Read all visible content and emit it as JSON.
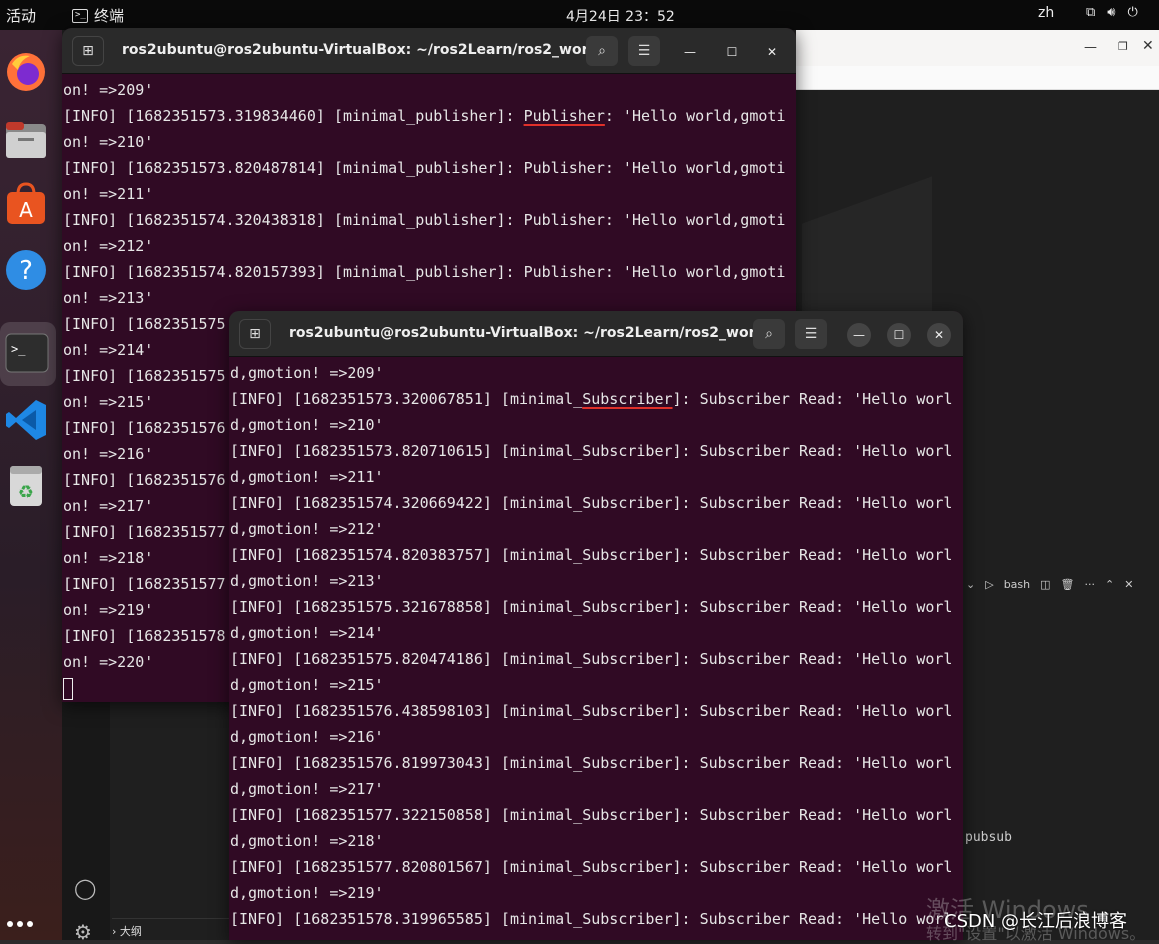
{
  "topbar": {
    "activities": "活动",
    "app": "终端",
    "clock": "4月24日  23：52",
    "lang": "zh"
  },
  "dock": {
    "items": [
      "firefox-icon",
      "files-icon",
      "app-center-icon",
      "help-icon",
      "terminal-icon",
      "vscode-icon",
      "trash-icon",
      "apps-grid-icon"
    ]
  },
  "bg": {
    "panel_label": "bash",
    "pubsub": "pubsub",
    "outline": "大纲"
  },
  "term1": {
    "title": "ros2ubuntu@ros2ubuntu-VirtualBox: ~/ros2Learn/ros2_work...",
    "lines": [
      "on! =>209'",
      "[INFO] [1682351573.319834460] [minimal_publisher]: Publisher: 'Hello world,gmoti",
      "on! =>210'",
      "[INFO] [1682351573.820487814] [minimal_publisher]: Publisher: 'Hello world,gmoti",
      "on! =>211'",
      "[INFO] [1682351574.320438318] [minimal_publisher]: Publisher: 'Hello world,gmoti",
      "on! =>212'",
      "[INFO] [1682351574.820157393] [minimal_publisher]: Publisher: 'Hello world,gmoti",
      "on! =>213'",
      "[INFO] [1682351575",
      "on! =>214'",
      "[INFO] [1682351575",
      "on! =>215'",
      "[INFO] [1682351576",
      "on! =>216'",
      "[INFO] [1682351576",
      "on! =>217'",
      "[INFO] [1682351577",
      "on! =>218'",
      "[INFO] [1682351577",
      "on! =>219'",
      "[INFO] [1682351578",
      "on! =>220'"
    ]
  },
  "term2": {
    "title": "ros2ubuntu@ros2ubuntu-VirtualBox: ~/ros2Learn/ros2_work...",
    "lines": [
      "d,gmotion! =>209'",
      "[INFO] [1682351573.320067851] [minimal_Subscriber]: Subscriber Read: 'Hello worl",
      "d,gmotion! =>210'",
      "[INFO] [1682351573.820710615] [minimal_Subscriber]: Subscriber Read: 'Hello worl",
      "d,gmotion! =>211'",
      "[INFO] [1682351574.320669422] [minimal_Subscriber]: Subscriber Read: 'Hello worl",
      "d,gmotion! =>212'",
      "[INFO] [1682351574.820383757] [minimal_Subscriber]: Subscriber Read: 'Hello worl",
      "d,gmotion! =>213'",
      "[INFO] [1682351575.321678858] [minimal_Subscriber]: Subscriber Read: 'Hello worl",
      "d,gmotion! =>214'",
      "[INFO] [1682351575.820474186] [minimal_Subscriber]: Subscriber Read: 'Hello worl",
      "d,gmotion! =>215'",
      "[INFO] [1682351576.438598103] [minimal_Subscriber]: Subscriber Read: 'Hello worl",
      "d,gmotion! =>216'",
      "[INFO] [1682351576.819973043] [minimal_Subscriber]: Subscriber Read: 'Hello worl",
      "d,gmotion! =>217'",
      "[INFO] [1682351577.322150858] [minimal_Subscriber]: Subscriber Read: 'Hello worl",
      "d,gmotion! =>218'",
      "[INFO] [1682351577.820801567] [minimal_Subscriber]: Subscriber Read: 'Hello worl",
      "d,gmotion! =>219'",
      "[INFO] [1682351578.319965585] [minimal_Subscriber]: Subscriber Read: 'Hello worl"
    ]
  },
  "watermark": {
    "line1": "激活 Windows",
    "line2": "转到\"设置\"以激活 Windows。",
    "csdn": "CSDN @长江后浪博客"
  }
}
